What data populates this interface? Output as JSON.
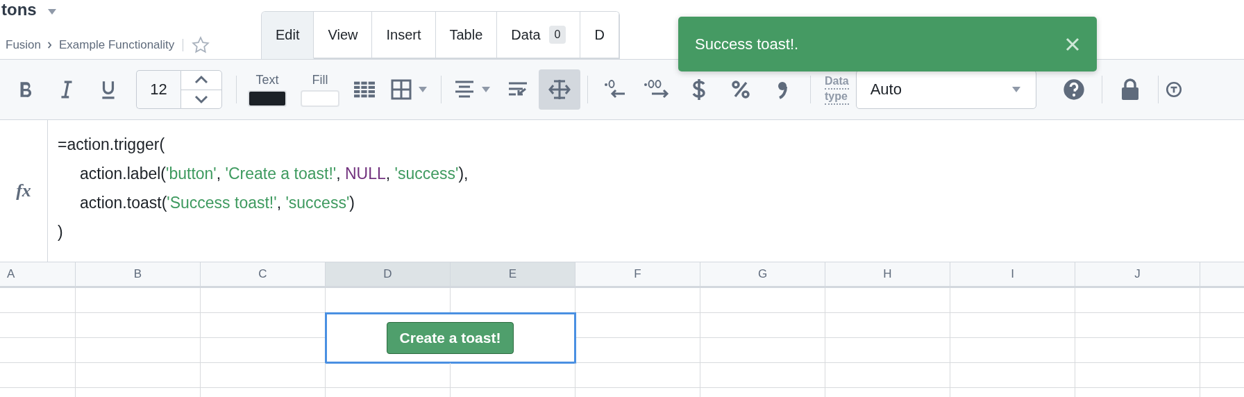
{
  "header": {
    "title": "tons",
    "breadcrumb": [
      "Fusion",
      "Example Functionality"
    ],
    "starred": false
  },
  "tabs": [
    {
      "label": "Edit",
      "selected": true
    },
    {
      "label": "View",
      "selected": false
    },
    {
      "label": "Insert",
      "selected": false
    },
    {
      "label": "Table",
      "selected": false
    },
    {
      "label": "Data",
      "selected": false,
      "badge": "0"
    },
    {
      "label": "D",
      "selected": false
    }
  ],
  "toast": {
    "message": "Success toast!.",
    "kind": "success"
  },
  "toolbar": {
    "font_size": "12",
    "swatches": [
      {
        "label": "Text",
        "color": "#1c2127"
      },
      {
        "label": "Fill",
        "color": "#ffffff"
      }
    ],
    "overflow_selected": true,
    "data_type_label": [
      "Data",
      "type"
    ],
    "data_type": "Auto"
  },
  "formula": {
    "icon": "fx",
    "lines": [
      {
        "indented": false,
        "tokens": [
          {
            "text": "=action.trigger(",
            "kind": "plain"
          }
        ]
      },
      {
        "indented": true,
        "tokens": [
          {
            "text": "action.label(",
            "kind": "plain"
          },
          {
            "text": "'button'",
            "kind": "string"
          },
          {
            "text": ", ",
            "kind": "plain"
          },
          {
            "text": "'Create a toast!'",
            "kind": "string"
          },
          {
            "text": ", ",
            "kind": "plain"
          },
          {
            "text": "NULL",
            "kind": "keyword"
          },
          {
            "text": ", ",
            "kind": "plain"
          },
          {
            "text": "'success'",
            "kind": "string"
          },
          {
            "text": "),",
            "kind": "plain"
          }
        ]
      },
      {
        "indented": true,
        "tokens": [
          {
            "text": "action.toast(",
            "kind": "plain"
          },
          {
            "text": "'Success toast!'",
            "kind": "string"
          },
          {
            "text": ", ",
            "kind": "plain"
          },
          {
            "text": "'success'",
            "kind": "string"
          },
          {
            "text": ")",
            "kind": "plain"
          }
        ]
      },
      {
        "indented": false,
        "tokens": [
          {
            "text": ")",
            "kind": "plain"
          }
        ]
      }
    ]
  },
  "grid": {
    "columns": [
      {
        "label": "A",
        "selected": false
      },
      {
        "label": "B",
        "selected": false
      },
      {
        "label": "C",
        "selected": false
      },
      {
        "label": "D",
        "selected": true
      },
      {
        "label": "E",
        "selected": true
      },
      {
        "label": "F",
        "selected": false
      },
      {
        "label": "G",
        "selected": false
      },
      {
        "label": "H",
        "selected": false
      },
      {
        "label": "I",
        "selected": false
      },
      {
        "label": "J",
        "selected": false
      }
    ],
    "button_cell": {
      "label": "Create a toast!",
      "selected": true
    }
  }
}
